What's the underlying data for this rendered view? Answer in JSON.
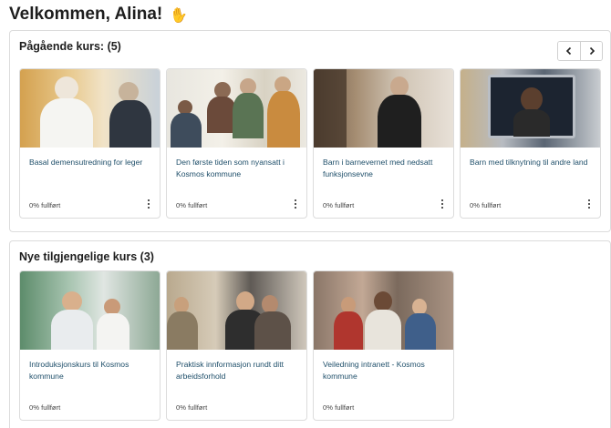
{
  "greeting": {
    "text": "Velkommen, Alina!",
    "emoji_icon": "waving-hand-icon"
  },
  "ongoing": {
    "title": "Pågående kurs: (5)",
    "nav": {
      "prev_icon": "chevron-left-icon",
      "next_icon": "chevron-right-icon"
    },
    "cards": [
      {
        "title": "Basal demensutredning for leger",
        "progress": "0% fullført"
      },
      {
        "title": "Den første tiden som nyansatt i Kosmos kommune",
        "progress": "0% fullført"
      },
      {
        "title": "Barn i barnevernet med nedsatt funksjonsevne",
        "progress": "0% fullført"
      },
      {
        "title": "Barn med tilknytning til andre land",
        "progress": "0% fullført"
      }
    ]
  },
  "available": {
    "title": "Nye tilgjengelige kurs (3)",
    "cards": [
      {
        "title": "Introduksjonskurs til Kosmos kommune",
        "progress": "0% fullført"
      },
      {
        "title": "Praktisk innformasjon rundt ditt arbeidsforhold",
        "progress": "0% fullført"
      },
      {
        "title": "Veiledning intranett - Kosmos kommune",
        "progress": "0% fullført"
      }
    ]
  },
  "colors": {
    "card_title": "#1f4f6a",
    "border": "#dcdcdc",
    "heading": "#1e1e1e"
  }
}
